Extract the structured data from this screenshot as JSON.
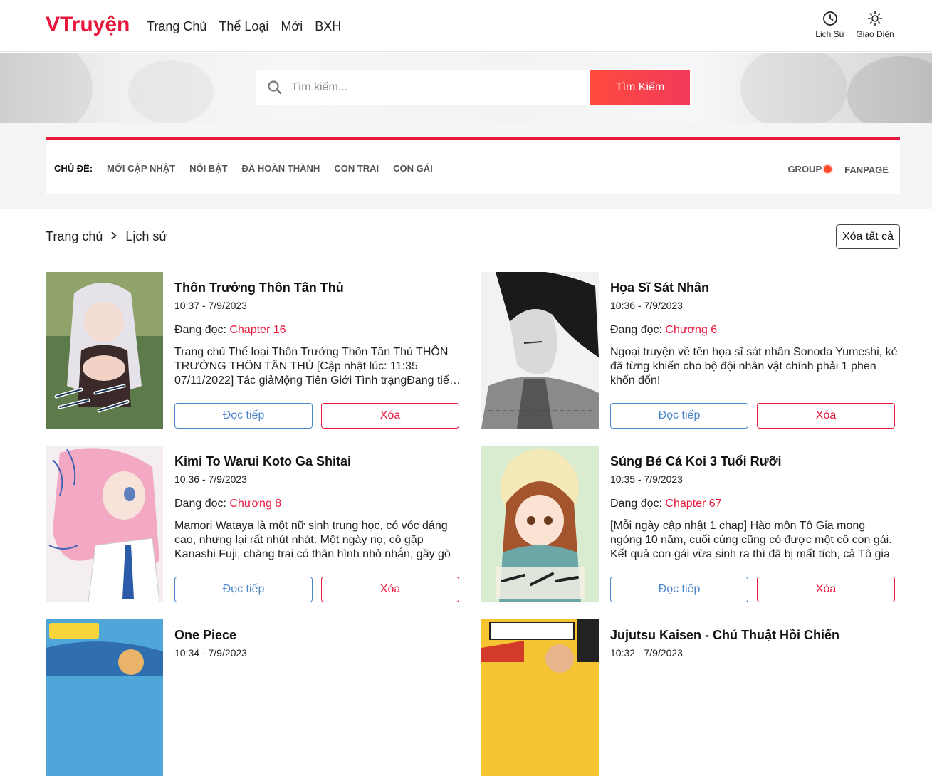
{
  "app": {
    "logo": "VTruyện",
    "brand_color": "#e8173c"
  },
  "nav": {
    "items": [
      "Trang Chủ",
      "Thể Loại",
      "Mới",
      "BXH"
    ]
  },
  "header_tools": {
    "history_label": "Lịch Sử",
    "theme_label": "Giao Diện"
  },
  "search": {
    "placeholder": "Tìm kiếm...",
    "button_label": "Tìm Kiếm"
  },
  "topics": {
    "label": "CHỦ ĐỀ:",
    "items": [
      "MỚI CẬP NHẬT",
      "NỔI BẬT",
      "ĐÃ HOÀN THÀNH",
      "CON TRAI",
      "CON GÁI"
    ],
    "group_label": "GROUP",
    "fanpage_label": "FANPAGE"
  },
  "breadcrumb": {
    "home": "Trang chủ",
    "separator": "›",
    "current": "Lịch sử"
  },
  "clear_all_label": "Xóa tất cả",
  "reading_prefix": "Đang đọc:",
  "read_label": "Đọc tiếp",
  "delete_label": "Xóa",
  "history": [
    {
      "title": "Thôn Trưởng Thôn Tân Thủ",
      "time": "10:37 - 7/9/2023",
      "chapter": "Chapter 16",
      "description": "Trang chủ   Thể loại   Thôn Trưởng Thôn Tân Thủ THÔN TRƯỞNG THÔN TÂN THỦ [Cập nhật lúc: 11:35 07/11/2022] Tác giảMộng Tiên Giới Tình trạngĐang tiến hành"
    },
    {
      "title": "Họa Sĩ Sát Nhân",
      "time": "10:36 - 7/9/2023",
      "chapter": "Chương 6",
      "description": "Ngoại truyện về tên họa sĩ sát nhân Sonoda Yumeshi, kẻ đã từng khiến cho bộ đội nhân vật chính phải 1 phen khốn đốn!"
    },
    {
      "title": "Kimi To Warui Koto Ga Shitai",
      "time": "10:36 - 7/9/2023",
      "chapter": "Chương 8",
      "description": "Mamori Wataya là một nữ sinh trung học, có vóc dáng cao, nhưng lại rất nhút nhát. Một ngày nọ, cô gặp Kanashi Fuji, chàng trai có thân hình nhỏ nhắn, gầy gò"
    },
    {
      "title": "Sủng Bé Cá Koi 3 Tuổi Rưỡi",
      "time": "10:35 - 7/9/2023",
      "chapter": "Chapter 67",
      "description": "[Mỗi ngày cập nhật 1 chap] Hào môn Tô Gia mong ngóng 10 năm, cuối cùng cũng có được một cô con gái. Kết quả con gái vừa sinh ra thì đã bị mất tích, cả Tô gia"
    },
    {
      "title": "One Piece",
      "time": "10:34 - 7/9/2023",
      "chapter": "",
      "description": ""
    },
    {
      "title": "Jujutsu Kaisen - Chú Thuật Hồi Chiến",
      "time": "10:32 - 7/9/2023",
      "chapter": "",
      "description": ""
    }
  ]
}
